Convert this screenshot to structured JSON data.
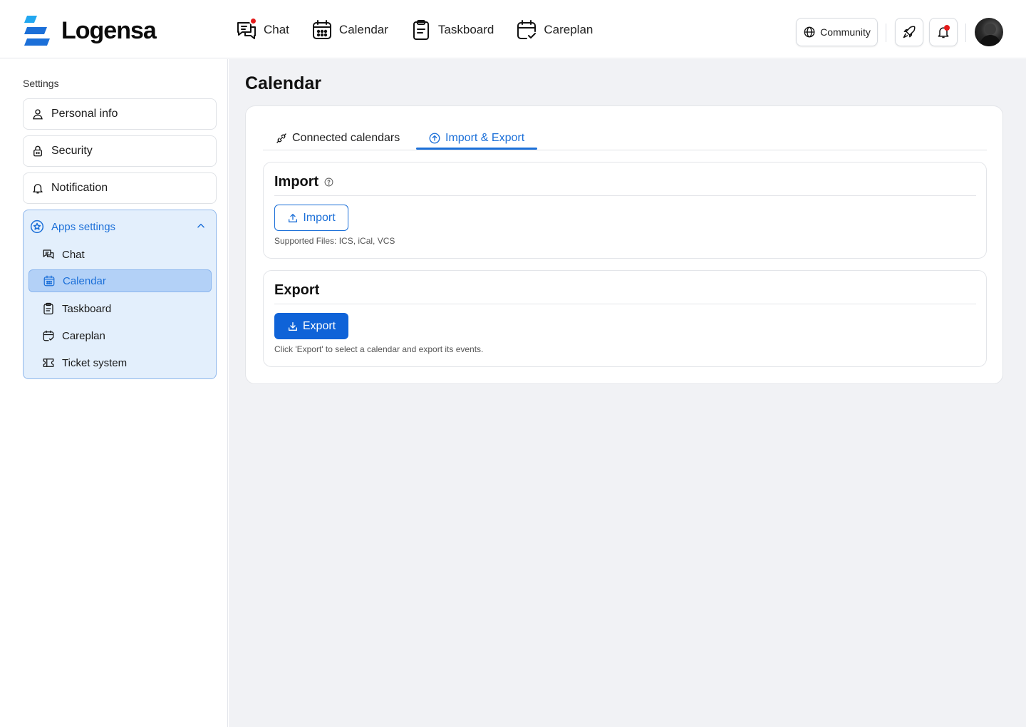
{
  "brand": {
    "name": "Logensa",
    "accent": "#1b6fd8"
  },
  "topnav": [
    {
      "label": "Chat",
      "icon": "chat-icon",
      "has_dot": true
    },
    {
      "label": "Calendar",
      "icon": "calendar-icon"
    },
    {
      "label": "Taskboard",
      "icon": "clipboard-icon"
    },
    {
      "label": "Careplan",
      "icon": "calendar-check-icon"
    }
  ],
  "header": {
    "community_label": "Community"
  },
  "sidebar": {
    "title": "Settings",
    "items": [
      {
        "label": "Personal info",
        "icon": "user-icon"
      },
      {
        "label": "Security",
        "icon": "lock-icon"
      },
      {
        "label": "Notification",
        "icon": "bell-icon"
      }
    ],
    "apps": {
      "label": "Apps settings",
      "expanded": true,
      "items": [
        {
          "label": "Chat",
          "icon": "chat-icon"
        },
        {
          "label": "Calendar",
          "icon": "calendar-icon",
          "active": true
        },
        {
          "label": "Taskboard",
          "icon": "clipboard-icon"
        },
        {
          "label": "Careplan",
          "icon": "calendar-check-icon"
        },
        {
          "label": "Ticket system",
          "icon": "ticket-icon"
        }
      ]
    }
  },
  "main": {
    "title": "Calendar",
    "tabs": [
      {
        "label": "Connected calendars",
        "icon": "link-icon"
      },
      {
        "label": "Import & Export",
        "icon": "upload-circle-icon",
        "active": true
      }
    ],
    "import": {
      "title": "Import",
      "button": "Import",
      "hint": "Supported Files: ICS, iCal, VCS"
    },
    "export": {
      "title": "Export",
      "button": "Export",
      "hint": "Click 'Export' to select a calendar and export its events."
    }
  }
}
